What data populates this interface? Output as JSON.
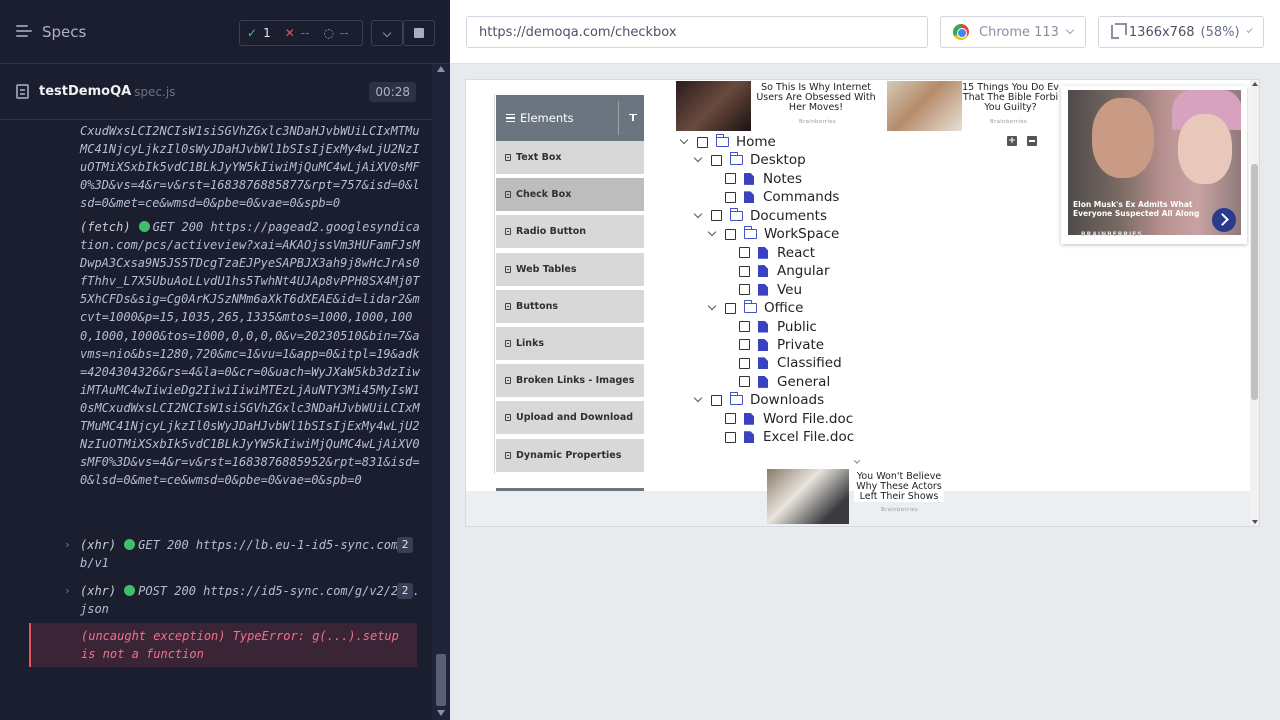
{
  "reporter": {
    "specs_label": "Specs",
    "stats": {
      "passed": "1",
      "failed": "--",
      "pending": "--"
    },
    "spec": {
      "name": "testDemoQA",
      "ext": "spec.js",
      "duration": "00:28"
    },
    "log_continuation": "CxudWxsLCI2NCIsW1siSGVhZGxlc3NDaHJvbWUiLCIxMTMuMC41NjcyLjkzIl0sWyJDaHJvbWl1bSIsIjExMy4wLjU2NzIuOTMiXSxbIk5vdC1BLkJyYW5kIiwiMjQuMC4wLjAiXV0sMF0%3D&vs=4&r=v&rst=1683876885877&rpt=757&isd=0&lsd=0&met=ce&wmsd=0&pbe=0&vae=0&spb=0",
    "entries": [
      {
        "kind": "(fetch)",
        "text": "GET 200 https://pagead2.googlesyndication.com/pcs/activeview?xai=AKAOjssVm3HUFamFJsMDwpA3Cxsa9N5JS5TDcgTzaEJPyeSAPBJX3ah9j8wHcJrAs0fThhv_L7X5UbuAoLLvdU1hs5TwhNt4UJAp8vPPH8SX4Mj0T5XhCFDs&sig=Cg0ArKJSzNMm6aXkT6dXEAE&id=lidar2&mcvt=1000&p=15,1035,265,1335&mtos=1000,1000,1000,1000,1000&tos=1000,0,0,0,0&v=20230510&bin=7&avms=nio&bs=1280,720&mc=1&vu=1&app=0&itpl=19&adk=4204304326&rs=4&la=0&cr=0&uach=WyJXaW5kb3dzIiwiMTAuMC4wIiwieDg2IiwiIiwiMTEzLjAuNTY3Mi45MyIsW10sMCxudWxsLCI2NCIsW1siSGVhZGxlc3NDaHJvbWUiLCIxMTMuMC41NjcyLjkzIl0sWyJDaHJvbWl1bSIsIjExMy4wLjU2NzIuOTMiXSxbIk5vdC1BLkJyYW5kIiwiMjQuMC4wLjAiXV0sMF0%3D&vs=4&r=v&rst=1683876885952&rpt=831&isd=0&lsd=0&met=ce&wmsd=0&pbe=0&vae=0&spb=0"
      },
      {
        "kind": "(xhr)",
        "text": "GET 200 https://lb.eu-1-id5-sync.com/lb/v1",
        "count": "2"
      },
      {
        "kind": "(xhr)",
        "text": "POST 200 https://id5-sync.com/g/v2/231.json",
        "count": "2"
      }
    ],
    "error": "(uncaught exception)  TypeError: g(...).setup is not a function"
  },
  "aut": {
    "url": "https://demoqa.com/checkbox",
    "browser": "Chrome 113",
    "viewport": "1366x768",
    "scale": "(58%)",
    "menu": {
      "header": "Elements",
      "items": [
        "Text Box",
        "Check Box",
        "Radio Button",
        "Web Tables",
        "Buttons",
        "Links",
        "Broken Links - Images",
        "Upload and Download",
        "Dynamic Properties"
      ],
      "active": "Check Box"
    },
    "tree": [
      {
        "label": "Home",
        "type": "folder",
        "expanded": true
      },
      {
        "label": "Desktop",
        "type": "folder",
        "expanded": true
      },
      {
        "label": "Notes",
        "type": "file"
      },
      {
        "label": "Commands",
        "type": "file"
      },
      {
        "label": "Documents",
        "type": "folder",
        "expanded": true
      },
      {
        "label": "WorkSpace",
        "type": "folder",
        "expanded": true
      },
      {
        "label": "React",
        "type": "file"
      },
      {
        "label": "Angular",
        "type": "file"
      },
      {
        "label": "Veu",
        "type": "file"
      },
      {
        "label": "Office",
        "type": "folder",
        "expanded": true
      },
      {
        "label": "Public",
        "type": "file"
      },
      {
        "label": "Private",
        "type": "file"
      },
      {
        "label": "Classified",
        "type": "file"
      },
      {
        "label": "General",
        "type": "file"
      },
      {
        "label": "Downloads",
        "type": "folder",
        "expanded": true
      },
      {
        "label": "Word File.doc",
        "type": "file"
      },
      {
        "label": "Excel File.doc",
        "type": "file"
      }
    ],
    "ads": {
      "top_left": {
        "text": "So This Is Why Internet Users Are Obsessed With Her Moves!",
        "brand": "Brainberries"
      },
      "top_mid": {
        "text": "15 Things You Do Ev That The Bible Forbi You Guilty?",
        "brand": "Brainberries"
      },
      "big": {
        "headline": "Elon Musk's Ex Admits What Everyone Suspected All Along",
        "brand": "BRAINBERRIES"
      },
      "bottom": {
        "text": "You Won't Believe Why These Actors Left Their Shows",
        "brand": "Brainberries"
      }
    }
  }
}
